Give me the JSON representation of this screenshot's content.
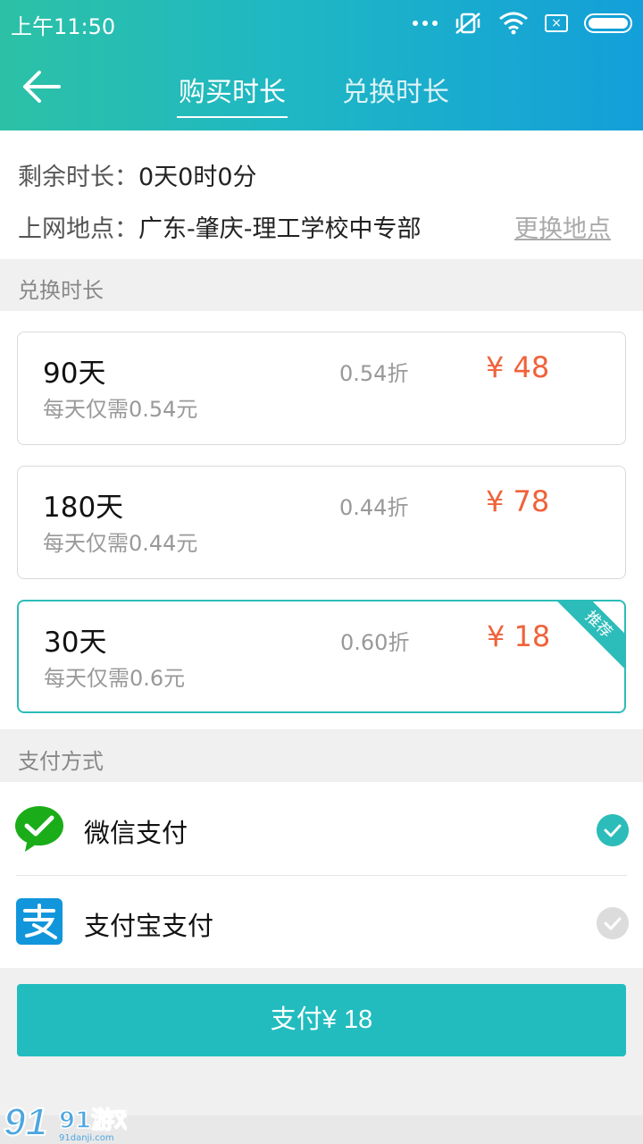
{
  "status_bar": {
    "time": "上午11:50",
    "icons": [
      "more-dots-icon",
      "mute-vibrate-icon",
      "wifi-icon",
      "sim-x-icon",
      "battery-icon"
    ]
  },
  "nav": {
    "back_icon": "arrow-left-icon",
    "tabs": [
      {
        "label": "购买时长",
        "active": true
      },
      {
        "label": "兑换时长",
        "active": false
      }
    ]
  },
  "info": {
    "remaining_label": "剩余时长：",
    "remaining_value": "0天0时0分",
    "location_label": "上网地点：",
    "location_value": "广东-肇庆-理工学校中专部",
    "change_location": "更换地点"
  },
  "plans_section_title": "兑换时长",
  "plans": [
    {
      "days": "90天",
      "daily": "每天仅需0.54元",
      "discount": "0.54折",
      "price": "¥ 48",
      "selected": false
    },
    {
      "days": "180天",
      "daily": "每天仅需0.44元",
      "discount": "0.44折",
      "price": "¥ 78",
      "selected": false
    },
    {
      "days": "30天",
      "daily": "每天仅需0.6元",
      "discount": "0.60折",
      "price": "¥ 18",
      "selected": true,
      "badge": "推荐"
    }
  ],
  "payment_section_title": "支付方式",
  "payment_methods": [
    {
      "label": "微信支付",
      "icon": "wechat-pay-icon",
      "checked": true
    },
    {
      "label": "支付宝支付",
      "icon": "alipay-icon",
      "checked": false
    }
  ],
  "pay_button": "支付¥ 18",
  "watermark": {
    "text": "91游戏",
    "sub": "91danji.com"
  },
  "colors": {
    "accent": "#22bcbf",
    "price": "#f0623a",
    "header_start": "#2cc1a6",
    "header_end": "#139fd9"
  }
}
